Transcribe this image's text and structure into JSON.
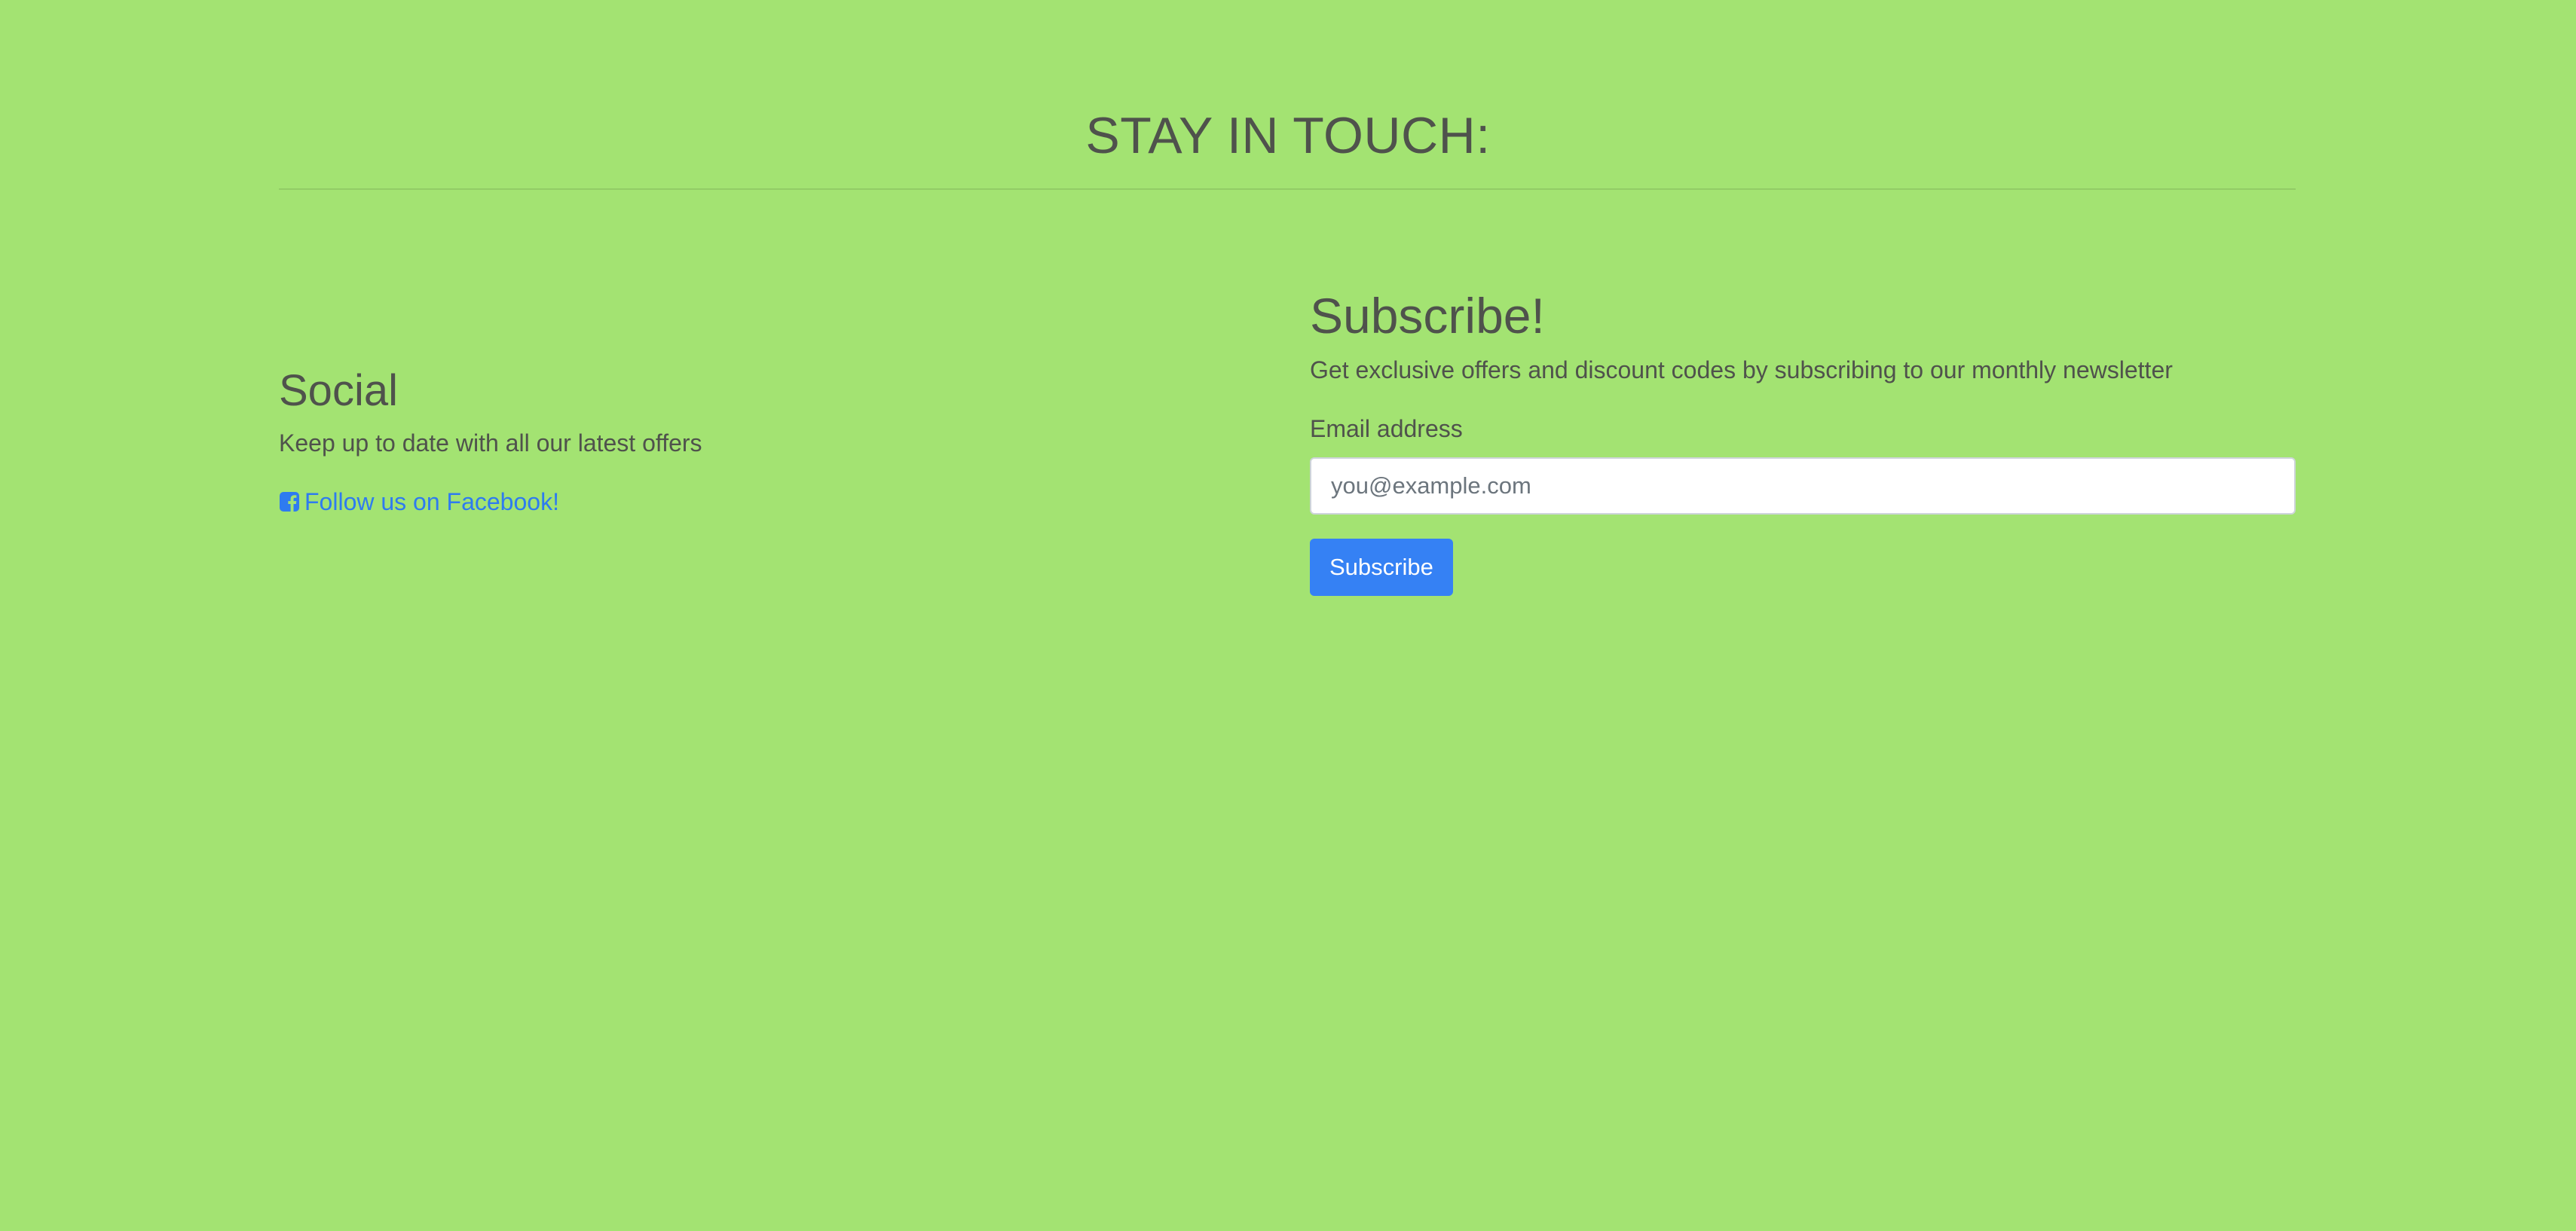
{
  "header": {
    "title": "STAY IN TOUCH:"
  },
  "social": {
    "title": "Social",
    "description": "Keep up to date with all our latest offers",
    "link_label": "Follow us on Facebook!",
    "link_icon": "facebook-square-icon"
  },
  "subscribe": {
    "title": "Subscribe!",
    "description": "Get exclusive offers and discount codes by subscribing to our monthly newsletter",
    "email_label": "Email address",
    "email_value": "",
    "email_placeholder": "you@example.com",
    "button_label": "Subscribe"
  },
  "colors": {
    "background": "#a3e372",
    "text": "#4f524c",
    "link": "#2e7bf0",
    "button": "#3581f4"
  }
}
